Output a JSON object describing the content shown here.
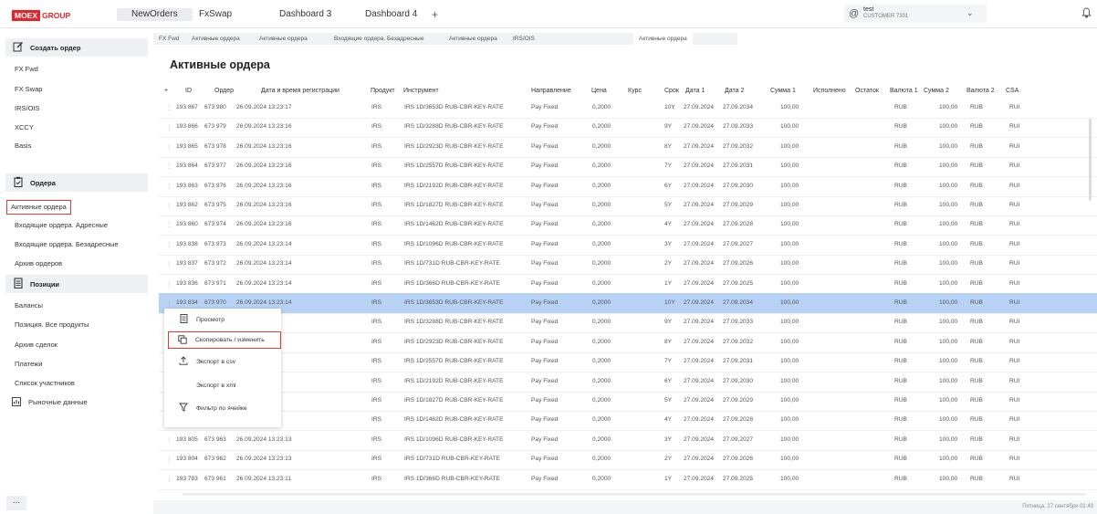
{
  "logo": {
    "box": "MOEX",
    "text": "GROUP"
  },
  "top_tabs": [
    {
      "label": "NewOrders",
      "active": true
    },
    {
      "label": "FxSwap",
      "active": false
    },
    {
      "label": "Dashboard 3",
      "active": false
    },
    {
      "label": "Dashboard 4",
      "active": false
    }
  ],
  "add_tab": "+",
  "user": {
    "name": "test",
    "org": "CUSTOMER 7301",
    "icon": "@",
    "dropdown": "⌄"
  },
  "bell_icon": "🔔",
  "sidebar": {
    "create_order": "Создать ордер",
    "create_items": [
      "FX Fwd",
      "FX Swap",
      "IRS/OIS",
      "XCCY",
      "Basis"
    ],
    "orders": "Ордера",
    "order_items": [
      "Активные ордера",
      "Входящие ордера. Адресные",
      "Входящие ордера. Безадресные",
      "Архив ордеров"
    ],
    "positions": "Позиции",
    "position_items": [
      "Балансы",
      "Позиция. Все продукты",
      "Архив сделок",
      "Платежи",
      "Список участников"
    ],
    "market_data": "Рыночные данные",
    "more": "..."
  },
  "sub_tabs": [
    "FX Fwd",
    "Активные ордера",
    "Активные ордера",
    "Входящие ордера. Безадресные",
    "Активные ордера",
    "IRS/OIS",
    "Активные ордера"
  ],
  "page_title": "Активные ордера",
  "columns": [
    "+",
    "ID",
    "Ордер",
    "Дата и время регистрации",
    "Продукт",
    "Инструмент",
    "Направление",
    "Цена",
    "Курс",
    "Срок",
    "Дата 1",
    "Дата 2",
    "Сумма 1",
    "Исполнено",
    "Остаток",
    "Валюта 1",
    "Сумма 2",
    "Валюта 2",
    "CSA"
  ],
  "rows": [
    {
      "id": "193 867",
      "order": "673 980",
      "dt": "26.09.2024 13:23:17",
      "product": "IRS",
      "instrument": "IRS 1D/3653D RUB-CBR-KEY-RATE",
      "dir": "Pay Fixed",
      "price": "0,2000",
      "term": "10Y",
      "d1": "27.09.2024",
      "d2": "27.09.2034",
      "s1": "100,00",
      "c1": "RUB",
      "s2": "100,00",
      "c2": "RUB",
      "csa": "RUI"
    },
    {
      "id": "193 866",
      "order": "673 979",
      "dt": "26.09.2024 13:23:16",
      "product": "IRS",
      "instrument": "IRS 1D/3288D RUB-CBR-KEY-RATE",
      "dir": "Pay Fixed",
      "price": "0,2000",
      "term": "9Y",
      "d1": "27.09.2024",
      "d2": "27.09.2033",
      "s1": "100,00",
      "c1": "RUB",
      "s2": "100,00",
      "c2": "RUB",
      "csa": "RUI"
    },
    {
      "id": "193 865",
      "order": "673 978",
      "dt": "26.09.2024 13:23:16",
      "product": "IRS",
      "instrument": "IRS 1D/2923D RUB-CBR-KEY-RATE",
      "dir": "Pay Fixed",
      "price": "0,2000",
      "term": "8Y",
      "d1": "27.09.2024",
      "d2": "27.09.2032",
      "s1": "100,00",
      "c1": "RUB",
      "s2": "100,00",
      "c2": "RUB",
      "csa": "RUI"
    },
    {
      "id": "193 864",
      "order": "673 977",
      "dt": "26.09.2024 13:23:16",
      "product": "IRS",
      "instrument": "IRS 1D/2557D RUB-CBR-KEY-RATE",
      "dir": "Pay Fixed",
      "price": "0,2000",
      "term": "7Y",
      "d1": "27.09.2024",
      "d2": "27.09.2031",
      "s1": "100,00",
      "c1": "RUB",
      "s2": "100,00",
      "c2": "RUB",
      "csa": "RUI"
    },
    {
      "id": "193 863",
      "order": "673 976",
      "dt": "26.09.2024 13:23:16",
      "product": "IRS",
      "instrument": "IRS 1D/2192D RUB-CBR-KEY-RATE",
      "dir": "Pay Fixed",
      "price": "0,2000",
      "term": "6Y",
      "d1": "27.09.2024",
      "d2": "27.09.2030",
      "s1": "100,00",
      "c1": "RUB",
      "s2": "100,00",
      "c2": "RUB",
      "csa": "RUI"
    },
    {
      "id": "193 862",
      "order": "673 975",
      "dt": "26.09.2024 13:23:16",
      "product": "IRS",
      "instrument": "IRS 1D/1827D RUB-CBR-KEY-RATE",
      "dir": "Pay Fixed",
      "price": "0,2000",
      "term": "5Y",
      "d1": "27.09.2024",
      "d2": "27.09.2029",
      "s1": "100,00",
      "c1": "RUB",
      "s2": "100,00",
      "c2": "RUB",
      "csa": "RUI"
    },
    {
      "id": "193 860",
      "order": "673 974",
      "dt": "26.09.2024 13:23:16",
      "product": "IRS",
      "instrument": "IRS 1D/1462D RUB-CBR-KEY-RATE",
      "dir": "Pay Fixed",
      "price": "0,2000",
      "term": "4Y",
      "d1": "27.09.2024",
      "d2": "27.09.2028",
      "s1": "100,00",
      "c1": "RUB",
      "s2": "100,00",
      "c2": "RUB",
      "csa": "RUI"
    },
    {
      "id": "193 838",
      "order": "673 973",
      "dt": "26.09.2024 13:23:14",
      "product": "IRS",
      "instrument": "IRS 1D/1096D RUB-CBR-KEY-RATE",
      "dir": "Pay Fixed",
      "price": "0,2000",
      "term": "3Y",
      "d1": "27.09.2024",
      "d2": "27.09.2027",
      "s1": "100,00",
      "c1": "RUB",
      "s2": "100,00",
      "c2": "RUB",
      "csa": "RUI"
    },
    {
      "id": "193 837",
      "order": "673 972",
      "dt": "26.09.2024 13:23:14",
      "product": "IRS",
      "instrument": "IRS 1D/731D RUB-CBR-KEY-RATE",
      "dir": "Pay Fixed",
      "price": "0,2000",
      "term": "2Y",
      "d1": "27.09.2024",
      "d2": "27.09.2026",
      "s1": "100,00",
      "c1": "RUB",
      "s2": "100,00",
      "c2": "RUB",
      "csa": "RUI"
    },
    {
      "id": "193 836",
      "order": "673 971",
      "dt": "26.09.2024 13:23:14",
      "product": "IRS",
      "instrument": "IRS 1D/366D RUB-CBR-KEY-RATE",
      "dir": "Pay Fixed",
      "price": "0,2000",
      "term": "1Y",
      "d1": "27.09.2024",
      "d2": "27.09.2025",
      "s1": "100,00",
      "c1": "RUB",
      "s2": "100,00",
      "c2": "RUB",
      "csa": "RUI"
    },
    {
      "id": "193 834",
      "order": "673 970",
      "dt": "26.09.2024 13:23:14",
      "product": "IRS",
      "instrument": "IRS 1D/3653D RUB-CBR-KEY-RATE",
      "dir": "Pay Fixed",
      "price": "0,2000",
      "term": "10Y",
      "d1": "27.09.2024",
      "d2": "27.09.2034",
      "s1": "100,00",
      "c1": "RUB",
      "s2": "100,00",
      "c2": "RUB",
      "csa": "RUI"
    },
    {
      "id": "",
      "order": "",
      "dt": "24 13:23:14",
      "product": "IRS",
      "instrument": "IRS 1D/3288D RUB-CBR-KEY-RATE",
      "dir": "Pay Fixed",
      "price": "0,2000",
      "term": "9Y",
      "d1": "27.09.2024",
      "d2": "27.09.2033",
      "s1": "100,00",
      "c1": "RUB",
      "s2": "100,00",
      "c2": "RUB",
      "csa": "RUI"
    },
    {
      "id": "",
      "order": "",
      "dt": "24 13:23:14",
      "product": "IRS",
      "instrument": "IRS 1D/2923D RUB-CBR-KEY-RATE",
      "dir": "Pay Fixed",
      "price": "0,2000",
      "term": "8Y",
      "d1": "27.09.2024",
      "d2": "27.09.2032",
      "s1": "100,00",
      "c1": "RUB",
      "s2": "100,00",
      "c2": "RUB",
      "csa": "RUI"
    },
    {
      "id": "",
      "order": "",
      "dt": "24 13:23:13",
      "product": "IRS",
      "instrument": "IRS 1D/2557D RUB-CBR-KEY-RATE",
      "dir": "Pay Fixed",
      "price": "0,2000",
      "term": "7Y",
      "d1": "27.09.2024",
      "d2": "27.09.2031",
      "s1": "100,00",
      "c1": "RUB",
      "s2": "100,00",
      "c2": "RUB",
      "csa": "RUI"
    },
    {
      "id": "",
      "order": "",
      "dt": "24 13:23:13",
      "product": "IRS",
      "instrument": "IRS 1D/2192D RUB-CBR-KEY-RATE",
      "dir": "Pay Fixed",
      "price": "0,2000",
      "term": "6Y",
      "d1": "27.09.2024",
      "d2": "27.09.2030",
      "s1": "100,00",
      "c1": "RUB",
      "s2": "100,00",
      "c2": "RUB",
      "csa": "RUI"
    },
    {
      "id": "",
      "order": "",
      "dt": "24 13:23:13",
      "product": "IRS",
      "instrument": "IRS 1D/1827D RUB-CBR-KEY-RATE",
      "dir": "Pay Fixed",
      "price": "0,2000",
      "term": "5Y",
      "d1": "27.09.2024",
      "d2": "27.09.2029",
      "s1": "100,00",
      "c1": "RUB",
      "s2": "100,00",
      "c2": "RUB",
      "csa": "RUI"
    },
    {
      "id": "",
      "order": "",
      "dt": "24 13:23:13",
      "product": "IRS",
      "instrument": "IRS 1D/1462D RUB-CBR-KEY-RATE",
      "dir": "Pay Fixed",
      "price": "0,2000",
      "term": "4Y",
      "d1": "27.09.2024",
      "d2": "27.09.2028",
      "s1": "100,00",
      "c1": "RUB",
      "s2": "100,00",
      "c2": "RUB",
      "csa": "RUI"
    },
    {
      "id": "193 805",
      "order": "673 963",
      "dt": "26.09.2024 13:23:13",
      "product": "IRS",
      "instrument": "IRS 1D/1096D RUB-CBR-KEY-RATE",
      "dir": "Pay Fixed",
      "price": "0,2000",
      "term": "3Y",
      "d1": "27.09.2024",
      "d2": "27.09.2027",
      "s1": "100,00",
      "c1": "RUB",
      "s2": "100,00",
      "c2": "RUB",
      "csa": "RUI"
    },
    {
      "id": "193 804",
      "order": "673 962",
      "dt": "26.09.2024 13:23:13",
      "product": "IRS",
      "instrument": "IRS 1D/731D RUB-CBR-KEY-RATE",
      "dir": "Pay Fixed",
      "price": "0,2000",
      "term": "2Y",
      "d1": "27.09.2024",
      "d2": "27.09.2026",
      "s1": "100,00",
      "c1": "RUB",
      "s2": "100,00",
      "c2": "RUB",
      "csa": "RUI"
    },
    {
      "id": "193 783",
      "order": "673 961",
      "dt": "26.09.2024 13:23:11",
      "product": "IRS",
      "instrument": "IRS 1D/366D RUB-CBR-KEY-RATE",
      "dir": "Pay Fixed",
      "price": "0,2000",
      "term": "1Y",
      "d1": "27.09.2024",
      "d2": "27.09.2025",
      "s1": "100,00",
      "c1": "RUB",
      "s2": "100,00",
      "c2": "RUB",
      "csa": "RUI"
    }
  ],
  "selected_row": 10,
  "context_menu": {
    "items": [
      {
        "label": "Просмотр",
        "icon": "document-icon"
      },
      {
        "label": "Скопировать / изменить",
        "icon": "copy-icon"
      },
      {
        "label": "Экспорт в csv",
        "icon": "upload-icon"
      },
      {
        "label": "Экспорт в xml",
        "icon": ""
      },
      {
        "label": "Фильтр по ячейке",
        "icon": "filter-icon"
      }
    ],
    "highlighted": 1
  },
  "footer_text": "Пятница, 27 сентября 01:49",
  "colors": {
    "brand": "#e3262b",
    "highlight": "#e03b2e",
    "selected_row": "#b7d2f5"
  }
}
